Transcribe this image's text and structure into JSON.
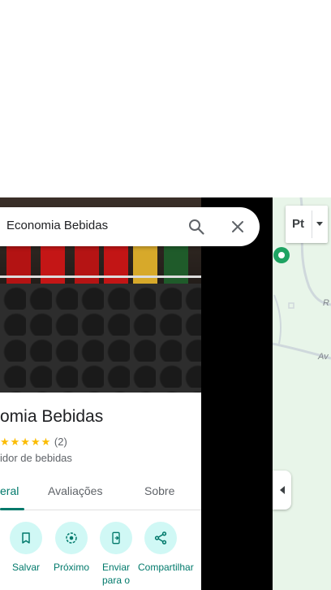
{
  "search": {
    "query": "Economia Bebidas"
  },
  "place": {
    "title": "omia Bebidas",
    "stars": "★★★★★",
    "rating_count": "(2)",
    "category": "idor de bebidas"
  },
  "tabs": [
    {
      "label": "eral",
      "active": true
    },
    {
      "label": "Avaliações",
      "active": false
    },
    {
      "label": "Sobre",
      "active": false
    }
  ],
  "actions": [
    {
      "label": "Salvar",
      "icon": "bookmark-icon"
    },
    {
      "label": "Próximo",
      "icon": "nearby-icon"
    },
    {
      "label": "Enviar para o",
      "icon": "send-to-phone-icon"
    },
    {
      "label": "Compartilhar",
      "icon": "share-icon"
    }
  ],
  "map": {
    "layer_label": "Pt",
    "labels": [
      "R",
      "Av"
    ]
  },
  "colors": {
    "accent": "#00796b",
    "action_bg": "#d0f8f5",
    "pin": "#1ea362"
  }
}
